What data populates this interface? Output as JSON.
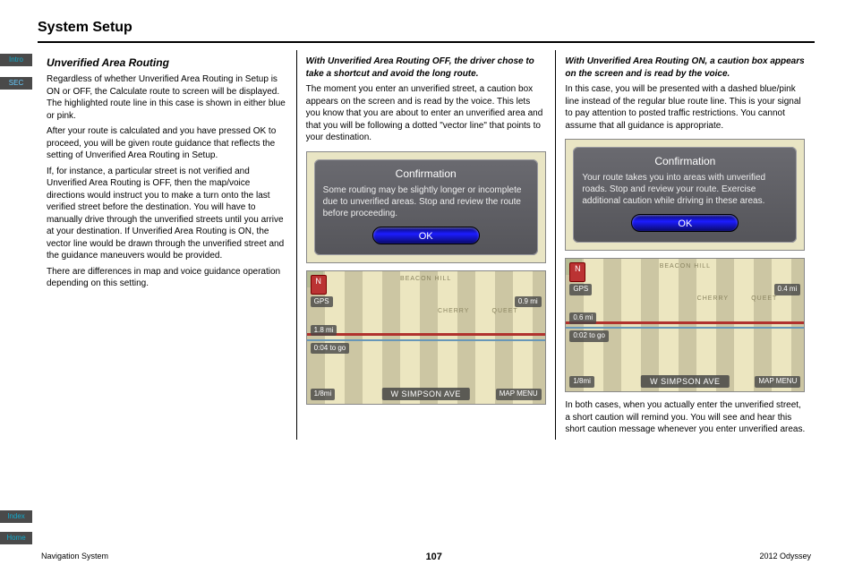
{
  "sidebar": {
    "intro": "Intro",
    "sec": "SEC",
    "index": "Index",
    "home": "Home"
  },
  "header": {
    "section_title": "System Setup"
  },
  "col1": {
    "h3": "Unverified Area Routing",
    "p1": "Regardless of whether Unverified Area Routing in Setup is ON or OFF, the Calculate route to screen will be displayed. The highlighted route line in this case is shown in either blue or pink.",
    "p2": "After your route is calculated and you have pressed OK to proceed, you will be given route guidance that reflects the setting of Unverified Area Routing in Setup.",
    "p3": "If, for instance, a particular street is not verified and Unverified Area Routing is OFF, then the map/voice directions would instruct you to make a turn onto the last verified street before the destination. You will have to manually drive through the unverified streets until you arrive at your destination. If Unverified Area Routing is ON, the vector line would be drawn through the unverified street and the guidance maneuvers would be provided.",
    "p4": "There are differences in map and voice guidance operation depending on this setting."
  },
  "col2": {
    "h4a": "With Unverified Area Routing OFF, the driver chose to take a shortcut and avoid the long route.",
    "p1": "The moment you enter an unverified street, a caution box appears on the screen and is read by the voice. This lets you know that you are about to enter an unverified area and that you will be following a dotted \"vector line\" that points to your destination.",
    "conf_title": "Confirmation",
    "conf_body": "Some routing may be slightly longer or incomplete due to unverified areas. Stop and review the route before proceeding.",
    "ok_label": "OK",
    "map": {
      "compass": "N",
      "gps": "GPS",
      "dist": "1.8 mi",
      "togo": "0:04 to go",
      "scale": "1/8mi",
      "nextdist": "0.9 mi",
      "menu": "MAP MENU",
      "street": "W SIMPSON AVE",
      "top_label": "BEACON HILL",
      "area1": "CHERRY",
      "area2": "QUEET"
    }
  },
  "col3": {
    "h4a": "With Unverified Area Routing ON, a caution box appears on the screen and is read by the voice.",
    "p1": "In this case, you will be presented with a dashed blue/pink line instead of the regular blue route line. This is your signal to pay attention to posted traffic restrictions. You cannot assume that all guidance is appropriate.",
    "conf_title": "Confirmation",
    "conf_body": "Your route takes you into areas with unverified roads. Stop and review your route. Exercise additional caution while driving in these areas.",
    "ok_label": "OK",
    "p2": "In both cases, when you actually enter the unverified street, a short caution will remind you. You will see and hear this short caution message whenever you enter unverified areas.",
    "map": {
      "compass": "N",
      "gps": "GPS",
      "dist": "0.6 mi",
      "togo": "0:02 to go",
      "scale": "1/8mi",
      "nextdist": "0.4 mi",
      "menu": "MAP MENU",
      "street": "W SIMPSON AVE",
      "top_label": "BEACON HILL",
      "area1": "CHERRY",
      "area2": "QUEET"
    }
  },
  "footer": {
    "left": "Navigation System",
    "page": "107",
    "right": "2012 Odyssey"
  }
}
